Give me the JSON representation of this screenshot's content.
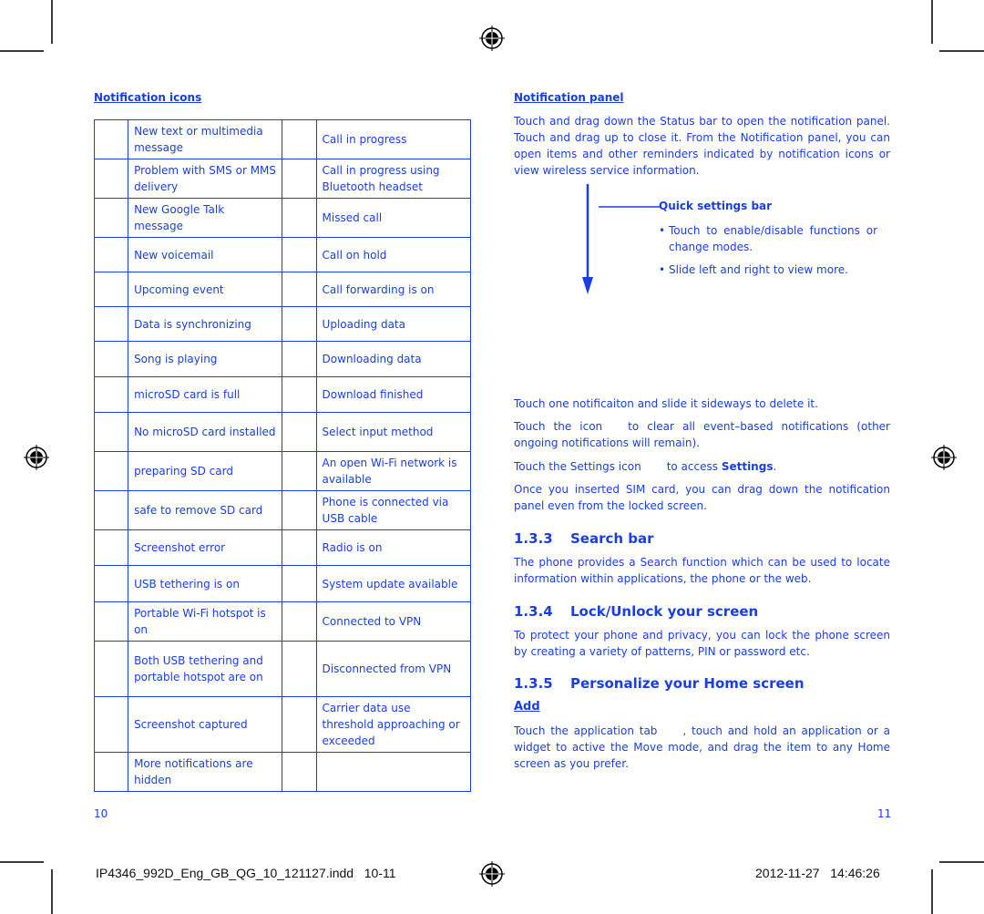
{
  "left_page": {
    "heading": "Notification icons",
    "table_rows": [
      {
        "left": "New text or multimedia message",
        "right": "Call in progress"
      },
      {
        "left": "Problem with SMS or MMS delivery",
        "right": "Call in progress using Bluetooth headset"
      },
      {
        "left": "New Google Talk message",
        "right": "Missed call"
      },
      {
        "left": "New voicemail",
        "right": "Call on hold"
      },
      {
        "left": "Upcoming event",
        "right": "Call forwarding is on"
      },
      {
        "left": "Data is synchronizing",
        "right": "Uploading data"
      },
      {
        "left": "Song is playing",
        "right": "Downloading data"
      },
      {
        "left": "microSD card is full",
        "right": "Download finished"
      },
      {
        "left": "No microSD card installed",
        "right": "Select input method"
      },
      {
        "left": "preparing SD card",
        "right": "An open Wi-Fi network is available"
      },
      {
        "left": "safe to remove SD card",
        "right": "Phone is connected via USB cable"
      },
      {
        "left": "Screenshot error",
        "right": "Radio is on"
      },
      {
        "left": "USB tethering is on",
        "right": "System update available"
      },
      {
        "left": "Portable Wi-Fi hotspot is on",
        "right": "Connected to VPN"
      },
      {
        "left": "Both USB tethering and portable hotspot are on",
        "right": "Disconnected from VPN"
      },
      {
        "left": "Screenshot captured",
        "right": "Carrier data use threshold approaching or exceeded"
      },
      {
        "left": "More notifications are hidden",
        "right": ""
      }
    ],
    "page_number": "10"
  },
  "right_page": {
    "heading": "Notification panel",
    "intro": "Touch and drag down the Status bar to open the notification panel. Touch and drag up to close it. From the Notification panel, you can open items and other reminders indicated by notification icons or view wireless service information.",
    "quick_settings": {
      "label": "Quick settings bar",
      "bullets": [
        "Touch to enable/disable functions or change modes.",
        "Slide left and right to view more."
      ]
    },
    "p_delete": "Touch one notificaiton and slide it sideways to delete it.",
    "p_clear_a": "Touch the icon",
    "p_clear_b": "to clear all event–based notifications (other ongoing notifications will remain).",
    "p_settings_a": "Touch the Settings icon",
    "p_settings_b": "to access",
    "p_settings_bold": "Settings",
    "p_settings_end": ".",
    "p_sim": "Once you inserted SIM card, you can drag down the notification panel even from the locked screen.",
    "sections": [
      {
        "num": "1.3.3",
        "title": "Search bar",
        "body": "The phone provides a Search function which can be used to locate information within applications, the phone or the web."
      },
      {
        "num": "1.3.4",
        "title": "Lock/Unlock your screen",
        "body": "To protect your phone and privacy, you can lock the phone screen by creating a variety of patterns, PIN or password etc."
      },
      {
        "num": "1.3.5",
        "title": "Personalize your Home screen"
      }
    ],
    "add_heading": "Add",
    "add_a": "Touch the application tab",
    "add_b": ", touch and hold an application or a widget to active the Move mode, and drag the item to any Home screen as you prefer.",
    "page_number": "11"
  },
  "slug": {
    "file": "IP4346_992D_Eng_GB_QG_10_121127.indd",
    "pages": "10-11",
    "datetime": "2012-11-27   14:46:26"
  }
}
